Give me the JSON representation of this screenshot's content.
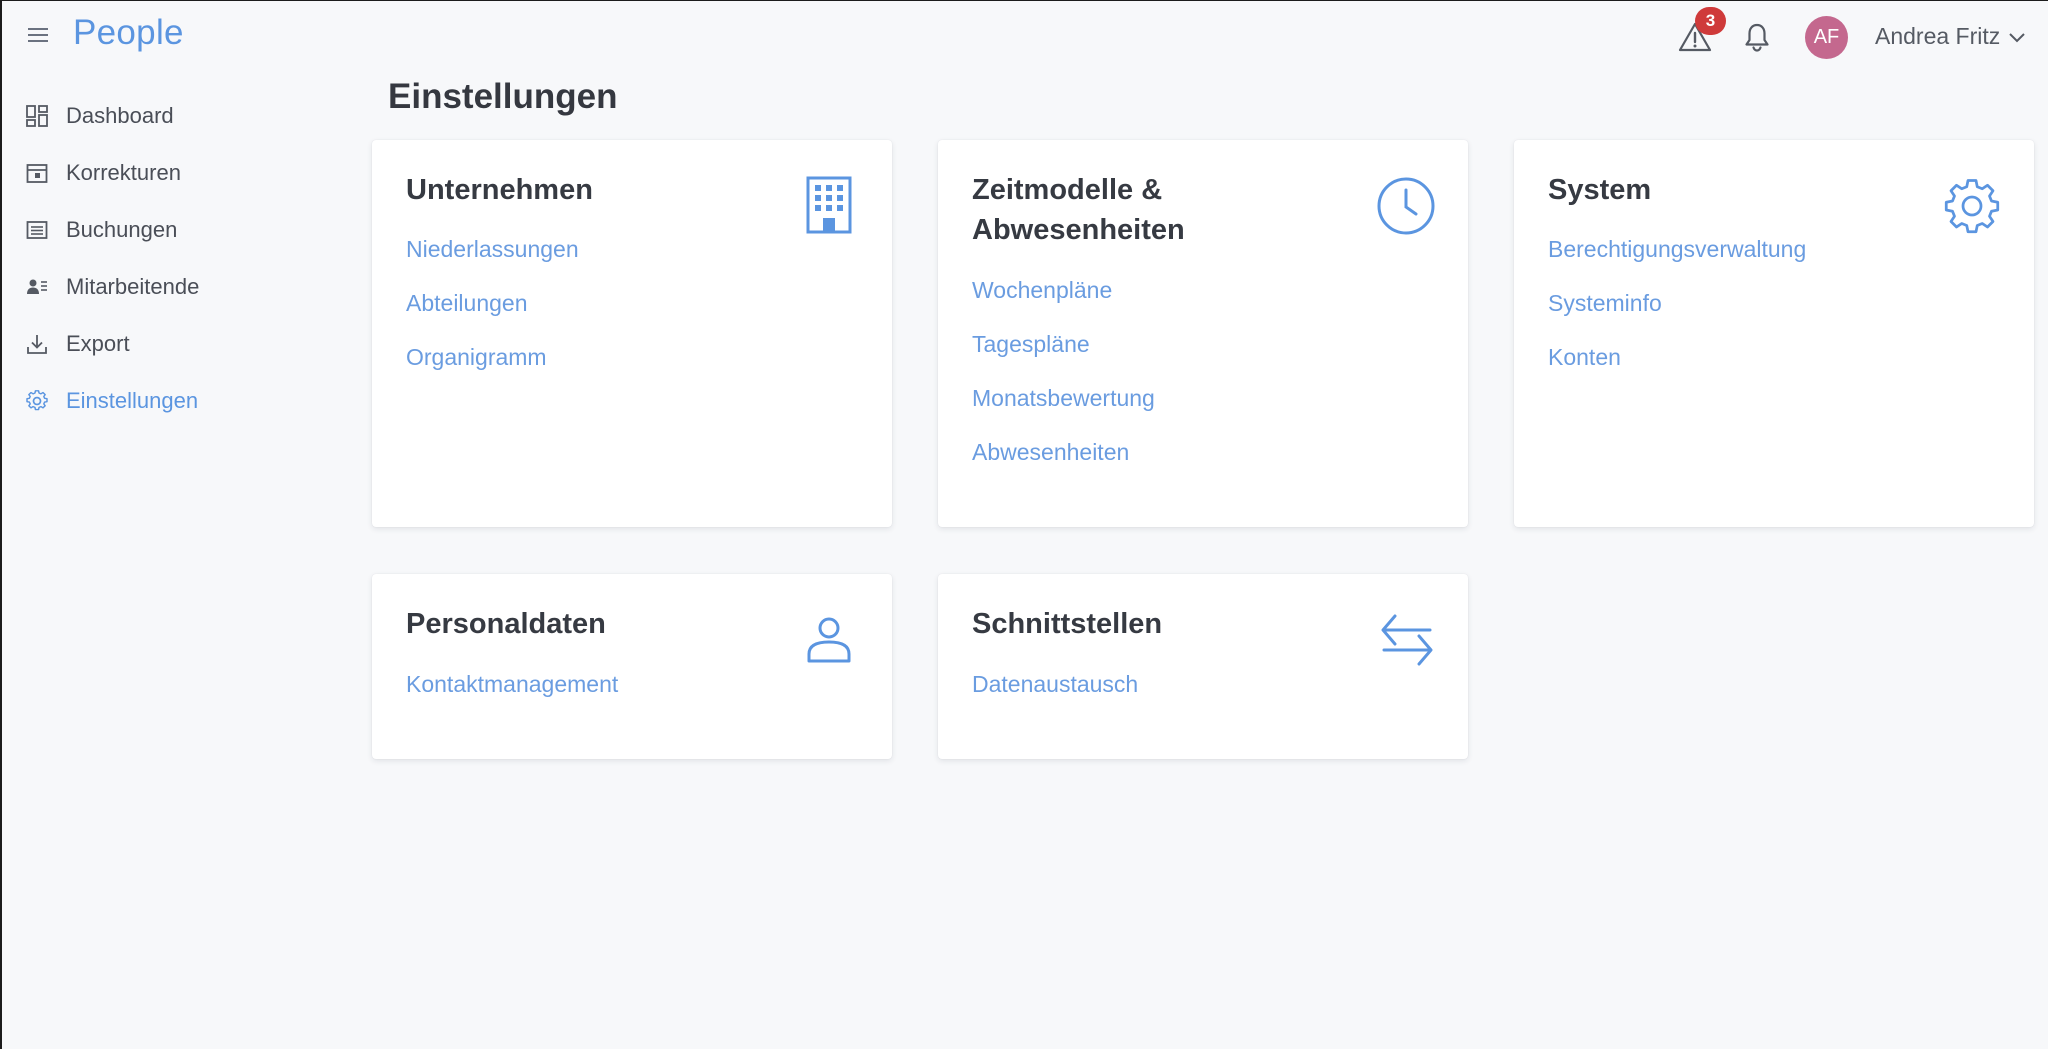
{
  "header": {
    "brand": "People",
    "alert_count": "3",
    "avatar_initials": "AF",
    "user_name": "Andrea Fritz"
  },
  "sidebar": {
    "items": [
      {
        "label": "Dashboard",
        "icon": "dashboard-icon"
      },
      {
        "label": "Korrekturen",
        "icon": "calendar-correction-icon"
      },
      {
        "label": "Buchungen",
        "icon": "list-icon"
      },
      {
        "label": "Mitarbeitende",
        "icon": "user-list-icon"
      },
      {
        "label": "Export",
        "icon": "download-icon"
      },
      {
        "label": "Einstellungen",
        "icon": "gear-icon",
        "active": true
      }
    ]
  },
  "page": {
    "title": "Einstellungen"
  },
  "cards": [
    {
      "title": "Unternehmen",
      "icon": "building-icon",
      "links": [
        "Niederlassungen",
        "Abteilungen",
        "Organigramm"
      ]
    },
    {
      "title_line1": "Zeitmodelle &",
      "title_line2": "Abwesenheiten",
      "icon": "clock-icon",
      "links": [
        "Wochenpläne",
        "Tagespläne",
        "Monatsbewertung",
        "Abwesenheiten"
      ]
    },
    {
      "title": "System",
      "icon": "gear-icon",
      "links": [
        "Berechtigungsverwaltung",
        "Systeminfo",
        "Konten"
      ]
    },
    {
      "title": "Personaldaten",
      "icon": "person-icon",
      "links": [
        "Kontaktmanagement"
      ]
    },
    {
      "title": "Schnittstellen",
      "icon": "swap-arrows-icon",
      "links": [
        "Datenaustausch"
      ]
    }
  ],
  "colors": {
    "accent": "#5b95e0",
    "link": "#6a9ce0",
    "badge": "#cf3a3a",
    "avatar": "#c4688e",
    "background": "#f7f8fa"
  }
}
